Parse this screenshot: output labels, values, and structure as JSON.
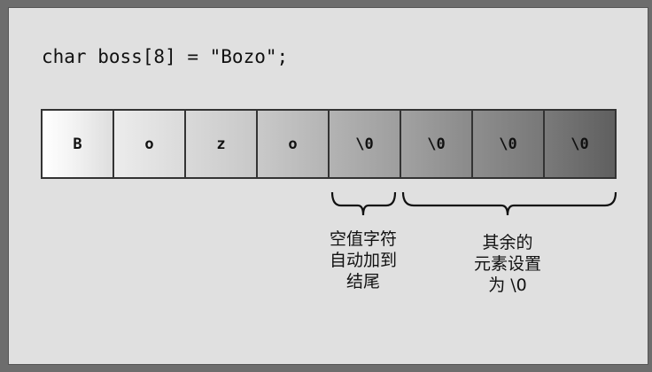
{
  "code_line": "char boss[8] = \"Bozo\";",
  "cells": [
    "B",
    "o",
    "z",
    "o",
    "\\0",
    "\\0",
    "\\0",
    "\\0"
  ],
  "annotations": {
    "null_char": [
      "空值字符",
      "自动加到",
      "结尾"
    ],
    "remaining": [
      "其余的",
      "元素设置",
      "为 \\0"
    ]
  }
}
